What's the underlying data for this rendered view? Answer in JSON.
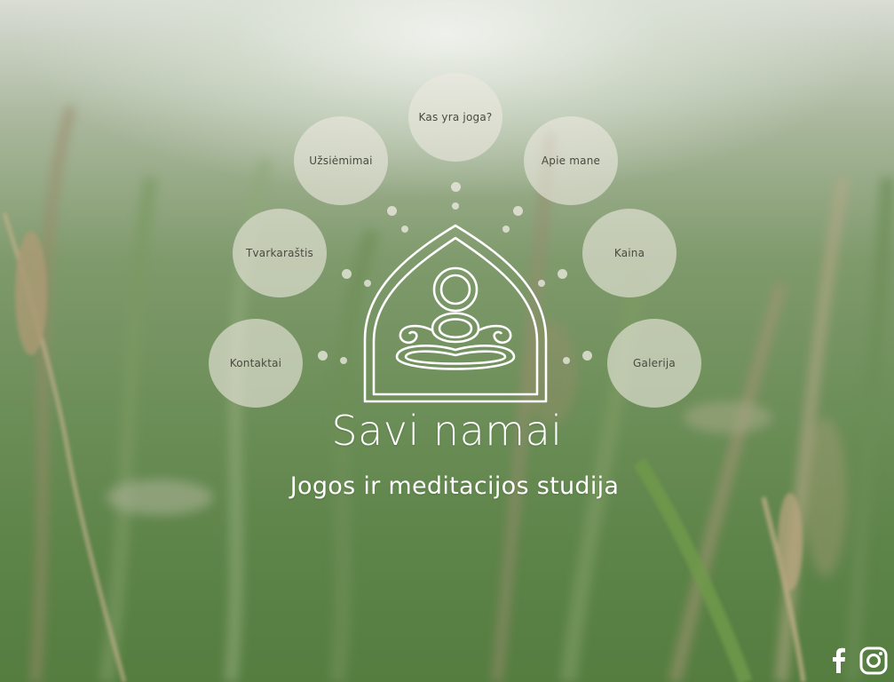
{
  "site": {
    "title": "Savi namai",
    "subtitle": "Jogos ir meditacijos studija"
  },
  "nav": {
    "items": [
      {
        "label": "Kas yra joga?"
      },
      {
        "label": "Užsiėmimai"
      },
      {
        "label": "Apie mane"
      },
      {
        "label": "Tvarkaraštis"
      },
      {
        "label": "Kaina"
      },
      {
        "label": "Kontaktai"
      },
      {
        "label": "Galerija"
      }
    ]
  },
  "social": {
    "facebook_icon": "facebook-icon",
    "instagram_icon": "instagram-icon"
  },
  "colors": {
    "bubble": "#ECE9DE",
    "text_on_bubble": "#4A4A40",
    "title": "#FFFFFF",
    "background_green": "#6E8F5A"
  }
}
